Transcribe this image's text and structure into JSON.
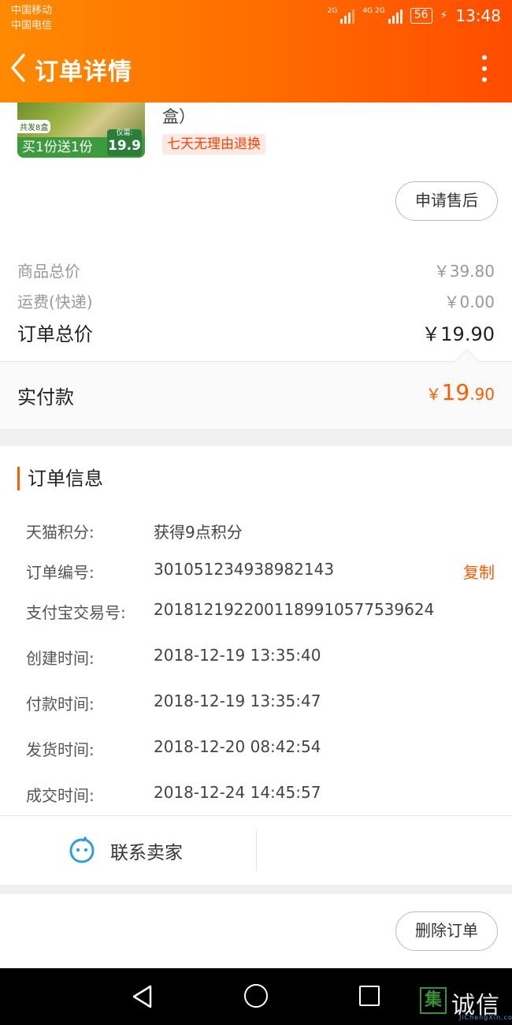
{
  "status_bar": {
    "carrier_1": "中国移动",
    "carrier_2": "中国电信",
    "signal_1_tag": "2G",
    "signal_2_tag": "4G 2G",
    "battery": "56",
    "time": "13:48"
  },
  "header": {
    "title": "订单详情",
    "accent_color": "#ff6a00"
  },
  "product": {
    "name_tail": "盒）",
    "thumb_count_tag": "共发8盒",
    "thumb_promo": "买1份送1份",
    "thumb_price_label": "仅需:",
    "thumb_price": "19.9",
    "return_badge": "七天无理由退换",
    "after_sale_label": "申请售后"
  },
  "summary": {
    "goods_total_label": "商品总价",
    "goods_total_value": "￥39.80",
    "shipping_label": "运费(快递)",
    "shipping_value": "￥0.00",
    "order_total_label": "订单总价",
    "order_total_value": "￥19.90",
    "paid_label": "实付款",
    "paid_currency": "￥",
    "paid_integer": "19",
    "paid_decimal": ".90"
  },
  "order_info": {
    "title": "订单信息",
    "points_label": "天猫积分:",
    "points_value": "获得9点积分",
    "order_no_label": "订单编号:",
    "order_no_value": "301051234938982143",
    "copy_label": "复制",
    "alipay_label": "支付宝交易号:",
    "alipay_value": "2018121922001189910577539624",
    "created_label": "创建时间:",
    "created_value": "2018-12-19 13:35:40",
    "paid_time_label": "付款时间:",
    "paid_time_value": "2018-12-19 13:35:47",
    "shipped_label": "发货时间:",
    "shipped_value": "2018-12-20 08:42:54",
    "closed_label": "成交时间:",
    "closed_value": "2018-12-24 14:45:57"
  },
  "contact": {
    "label": "联系卖家"
  },
  "actions": {
    "delete_label": "删除订单"
  },
  "watermark": {
    "box_char": "集",
    "text": "诚信",
    "sub": "JiChengXin.com"
  }
}
